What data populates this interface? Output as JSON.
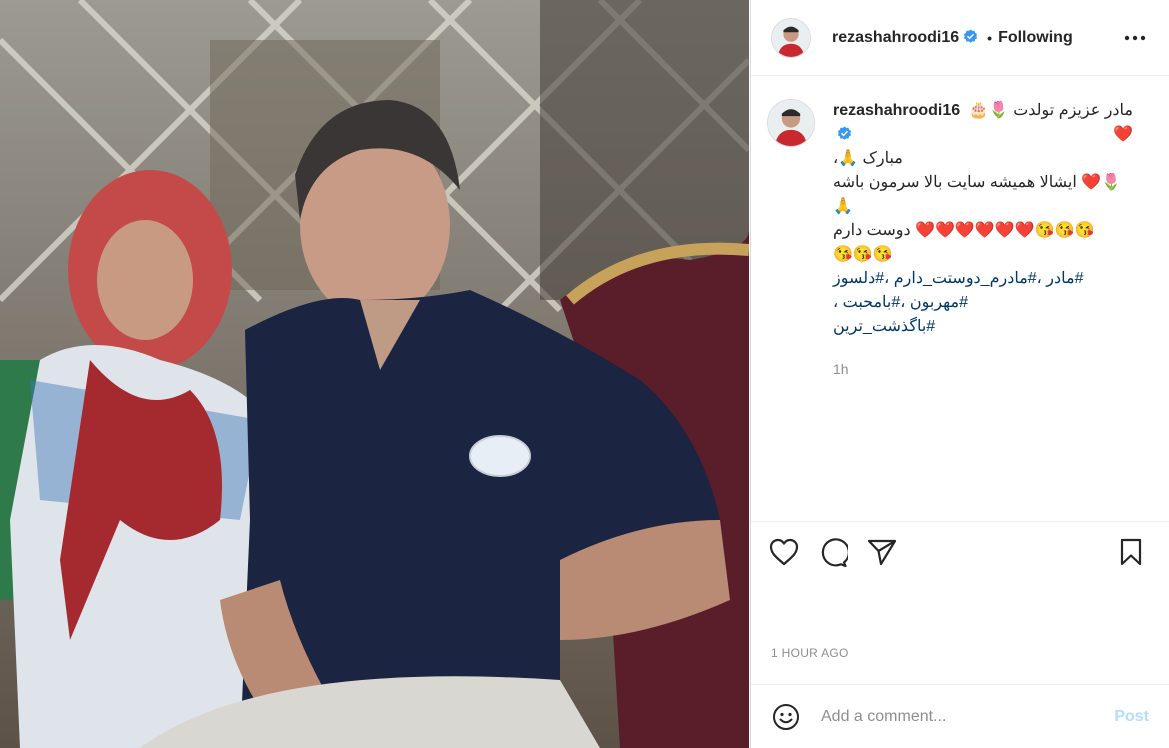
{
  "post": {
    "username": "rezashahroodi16",
    "follow_status": "Following",
    "dot": "•"
  },
  "caption": {
    "username": "rezashahroodi16",
    "line1": "مادر عزیزم تولدت 🌷🎂❤️",
    "line2": "مبارک 🙏،",
    "line3": "🌷❤️ ایشالا همیشه سایت بالا سرمون باشه",
    "line4": "🙏",
    "line5": "😘😘😘❤️❤️❤️❤️❤️❤️ دوست دارم",
    "line6": "😘😘😘",
    "hashtags1": "#مادر ،#مادرم_دوستت_دارم ،#دلسوز",
    "hashtags2": "#مهربون ،#بامحبت ،",
    "hashtags3": "#باگذشت_ترین",
    "age": "1h"
  },
  "timestamp": "1 HOUR AGO",
  "comment_box": {
    "placeholder": "Add a comment...",
    "post_label": "Post"
  },
  "icons": {
    "verified": "verified-badge-icon",
    "more": "more-options-icon",
    "like": "heart-icon",
    "comment": "comment-icon",
    "share": "paper-plane-icon",
    "save": "bookmark-icon",
    "emoji": "emoji-icon"
  },
  "colors": {
    "verified_blue": "#3897f0",
    "link": "#00376b",
    "muted": "#8e8e8e",
    "post_disabled": "#b2dffc"
  }
}
